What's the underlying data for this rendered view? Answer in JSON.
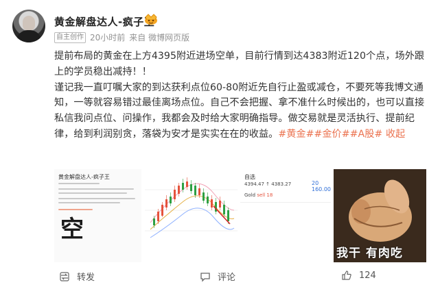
{
  "post": {
    "author": "黄金解盘达人-疯子王",
    "badge": "自主创作",
    "time": "20小时前",
    "source": "来自 微博网页版",
    "para1": "提前布局的黄金在上方4395附近进场空单，目前行情到达4383附近120个点，场外跟上的学员稳出减持！！",
    "para2": "谨记我一直叮嘱大家的到达获利点位60-80附近先自行止盈或减仓，不要死等我博文通知，一等就容易错过最佳离场点位。自己不会把握、拿不准什么时候出的，也可以直接私信我问点位、问操作，我都会及时给大家明确指导。做交易就是灵活执行、提前纪律，给到利润别贪，落袋为安才是实实在在的收益。",
    "tag1": "#黄金#",
    "tag2": "#金价#",
    "tag3": "#A股#",
    "collapse": "收起"
  },
  "images": {
    "img1_char": "空",
    "img1_header": "黄金解盘达人-疯子王",
    "img3_header": "自选",
    "img3_row1": "4394.47 ↑ 4383.27",
    "img3_row2_name": "Gold",
    "img3_row2_sell": "sell 18",
    "img3_price": "20 160.00",
    "img4_caption": "我干  有肉吃"
  },
  "actions": {
    "repost": "转发",
    "comment": "评论",
    "like_count": "124"
  },
  "colors": {
    "tag": "#eb7350",
    "meta": "#939393",
    "text": "#333333"
  },
  "icons": [
    "crown-icon",
    "repost-icon",
    "comment-icon",
    "like-icon"
  ]
}
